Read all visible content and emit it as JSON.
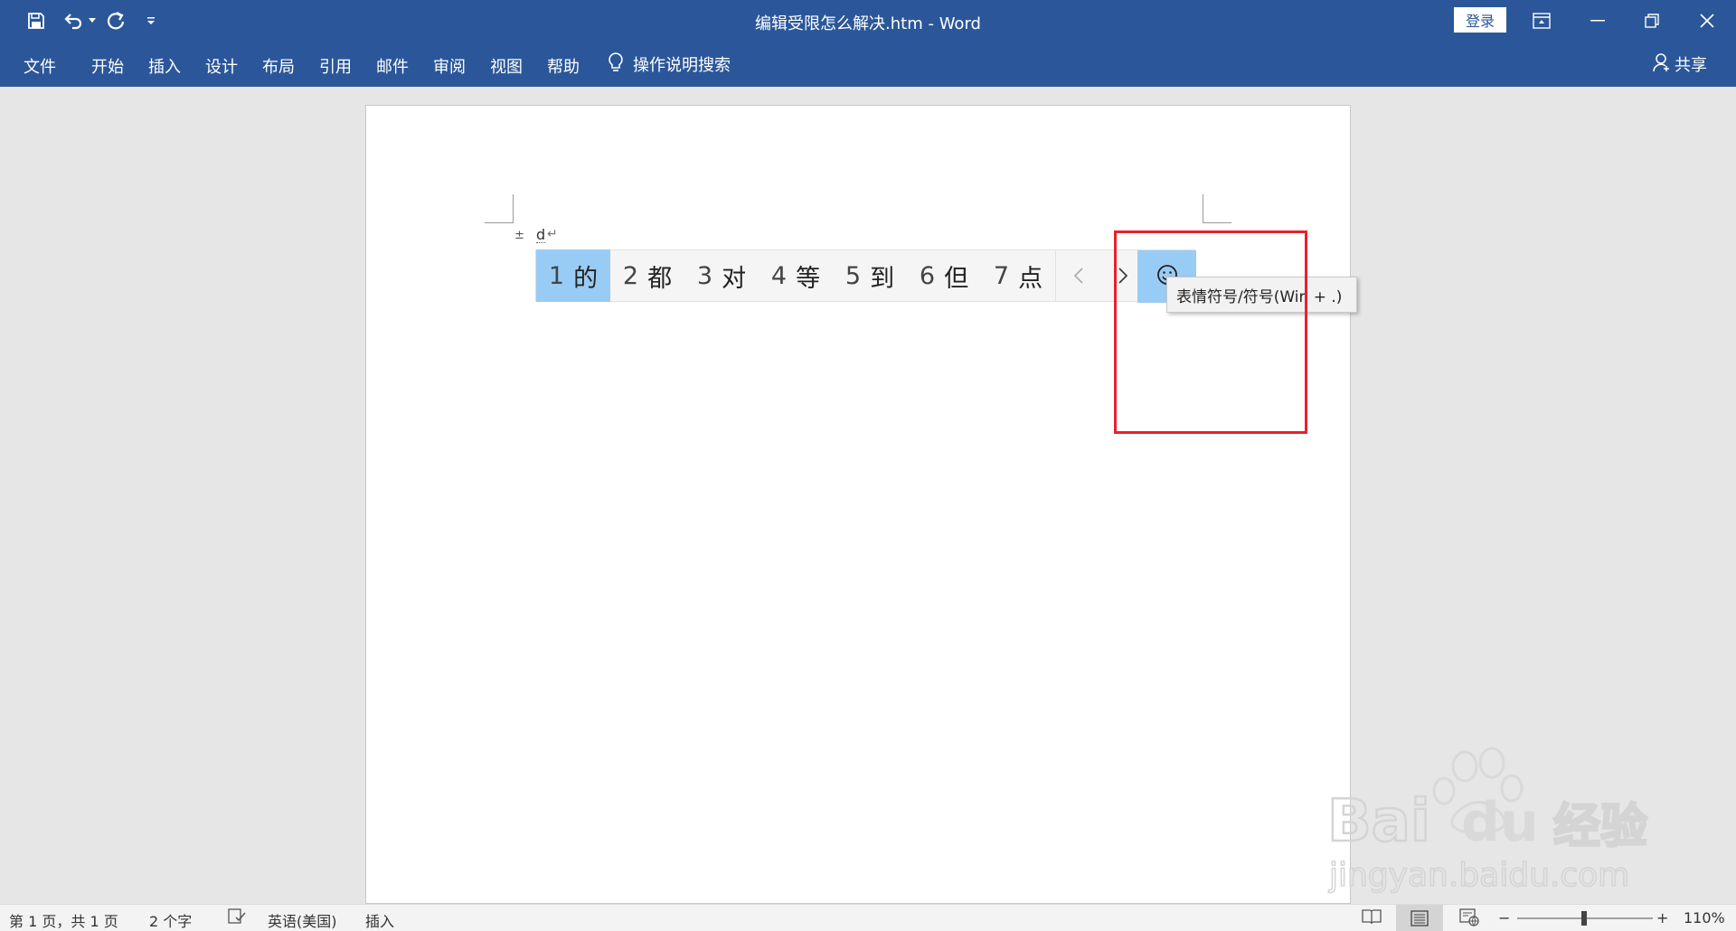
{
  "titlebar": {
    "title": "编辑受限怎么解决.htm  -  Word",
    "login_label": "登录",
    "quick_access": [
      "save-icon",
      "undo-icon",
      "redo-icon",
      "customize-icon"
    ],
    "window_controls": [
      "ribbon-display-icon",
      "minimize-icon",
      "restore-icon",
      "close-icon"
    ]
  },
  "ribbon": {
    "tabs": [
      "文件",
      "开始",
      "插入",
      "设计",
      "布局",
      "引用",
      "邮件",
      "审阅",
      "视图",
      "帮助"
    ],
    "search_label": "操作说明搜索",
    "share_label": "共享"
  },
  "document": {
    "anchor_mark": "±",
    "typed_text": "d",
    "paragraph_mark": "↵"
  },
  "ime": {
    "candidates": [
      {
        "num": "1",
        "char": "的"
      },
      {
        "num": "2",
        "char": "都"
      },
      {
        "num": "3",
        "char": "对"
      },
      {
        "num": "4",
        "char": "等"
      },
      {
        "num": "5",
        "char": "到"
      },
      {
        "num": "6",
        "char": "但"
      },
      {
        "num": "7",
        "char": "点"
      }
    ],
    "selected_index": 0,
    "tooltip": "表情符号/符号(Win + .)"
  },
  "statusbar": {
    "page_info": "第 1 页，共 1 页",
    "word_count": "2 个字",
    "language": "英语(美国)",
    "mode": "插入",
    "zoom_minus": "−",
    "zoom_plus": "+",
    "zoom_level": "110%"
  },
  "watermark": {
    "brand": "Bai  经验",
    "url": "jingyan.baidu.com"
  },
  "colors": {
    "titlebar_bg": "#2b579a",
    "candidate_highlight": "#99ccf5",
    "annotation_red": "#e8212b"
  }
}
